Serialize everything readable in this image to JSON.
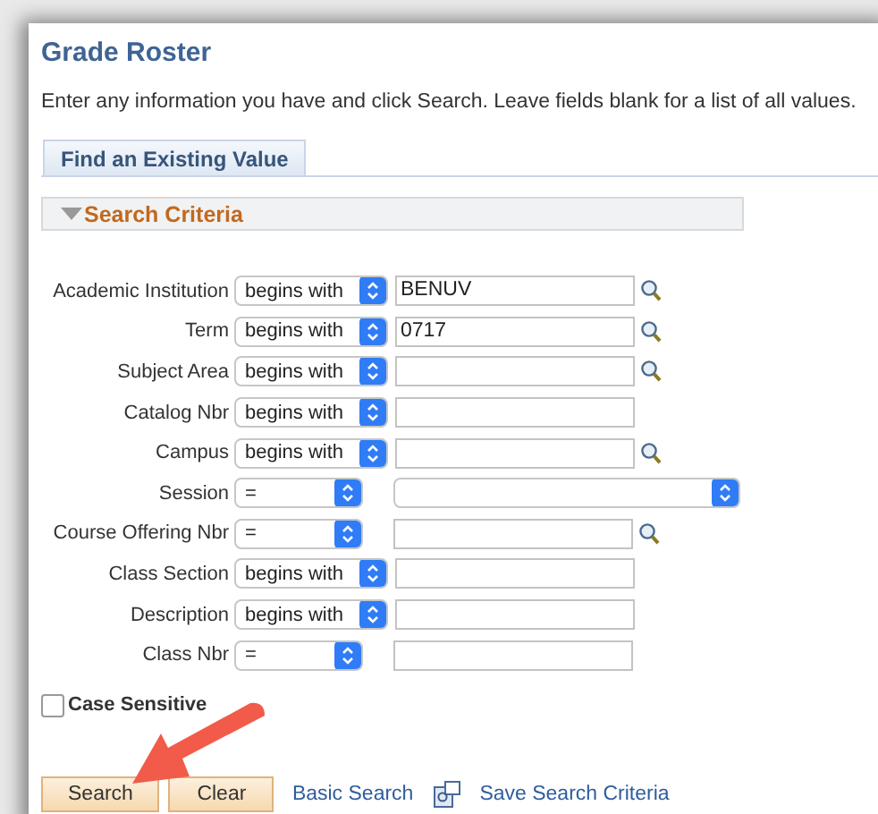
{
  "page": {
    "title": "Grade Roster",
    "instructions": "Enter any information you have and click Search. Leave fields blank for a list of all values."
  },
  "tabs": [
    {
      "label": "Find an Existing Value",
      "selected": true
    }
  ],
  "section": {
    "title": "Search Criteria",
    "expanded": true
  },
  "fields": [
    {
      "label": "Academic Institution",
      "operator": "begins with",
      "kind": "text",
      "value": "BENUV",
      "lookup": true
    },
    {
      "label": "Term",
      "operator": "begins with",
      "kind": "text",
      "value": "0717",
      "lookup": true
    },
    {
      "label": "Subject Area",
      "operator": "begins with",
      "kind": "text",
      "lookup": true
    },
    {
      "label": "Catalog Nbr",
      "operator": "begins with",
      "kind": "text",
      "lookup": false
    },
    {
      "label": "Campus",
      "operator": "begins with",
      "kind": "text",
      "lookup": true
    },
    {
      "label": "Session",
      "operator": "=",
      "kind": "select",
      "lookup": false
    },
    {
      "label": "Course Offering Nbr",
      "operator": "=",
      "kind": "text",
      "lookup": true
    },
    {
      "label": "Class Section",
      "operator": "begins with",
      "kind": "text",
      "lookup": false
    },
    {
      "label": "Description",
      "operator": "begins with",
      "kind": "text",
      "lookup": false
    },
    {
      "label": "Class Nbr",
      "operator": "=",
      "kind": "text",
      "lookup": false
    }
  ],
  "case_sensitive": {
    "label": "Case Sensitive",
    "checked": false
  },
  "buttons": [
    "Search",
    "Clear"
  ],
  "links": [
    {
      "label": "Basic Search",
      "icon": false
    },
    {
      "label": "Save Search Criteria",
      "icon": true
    }
  ]
}
